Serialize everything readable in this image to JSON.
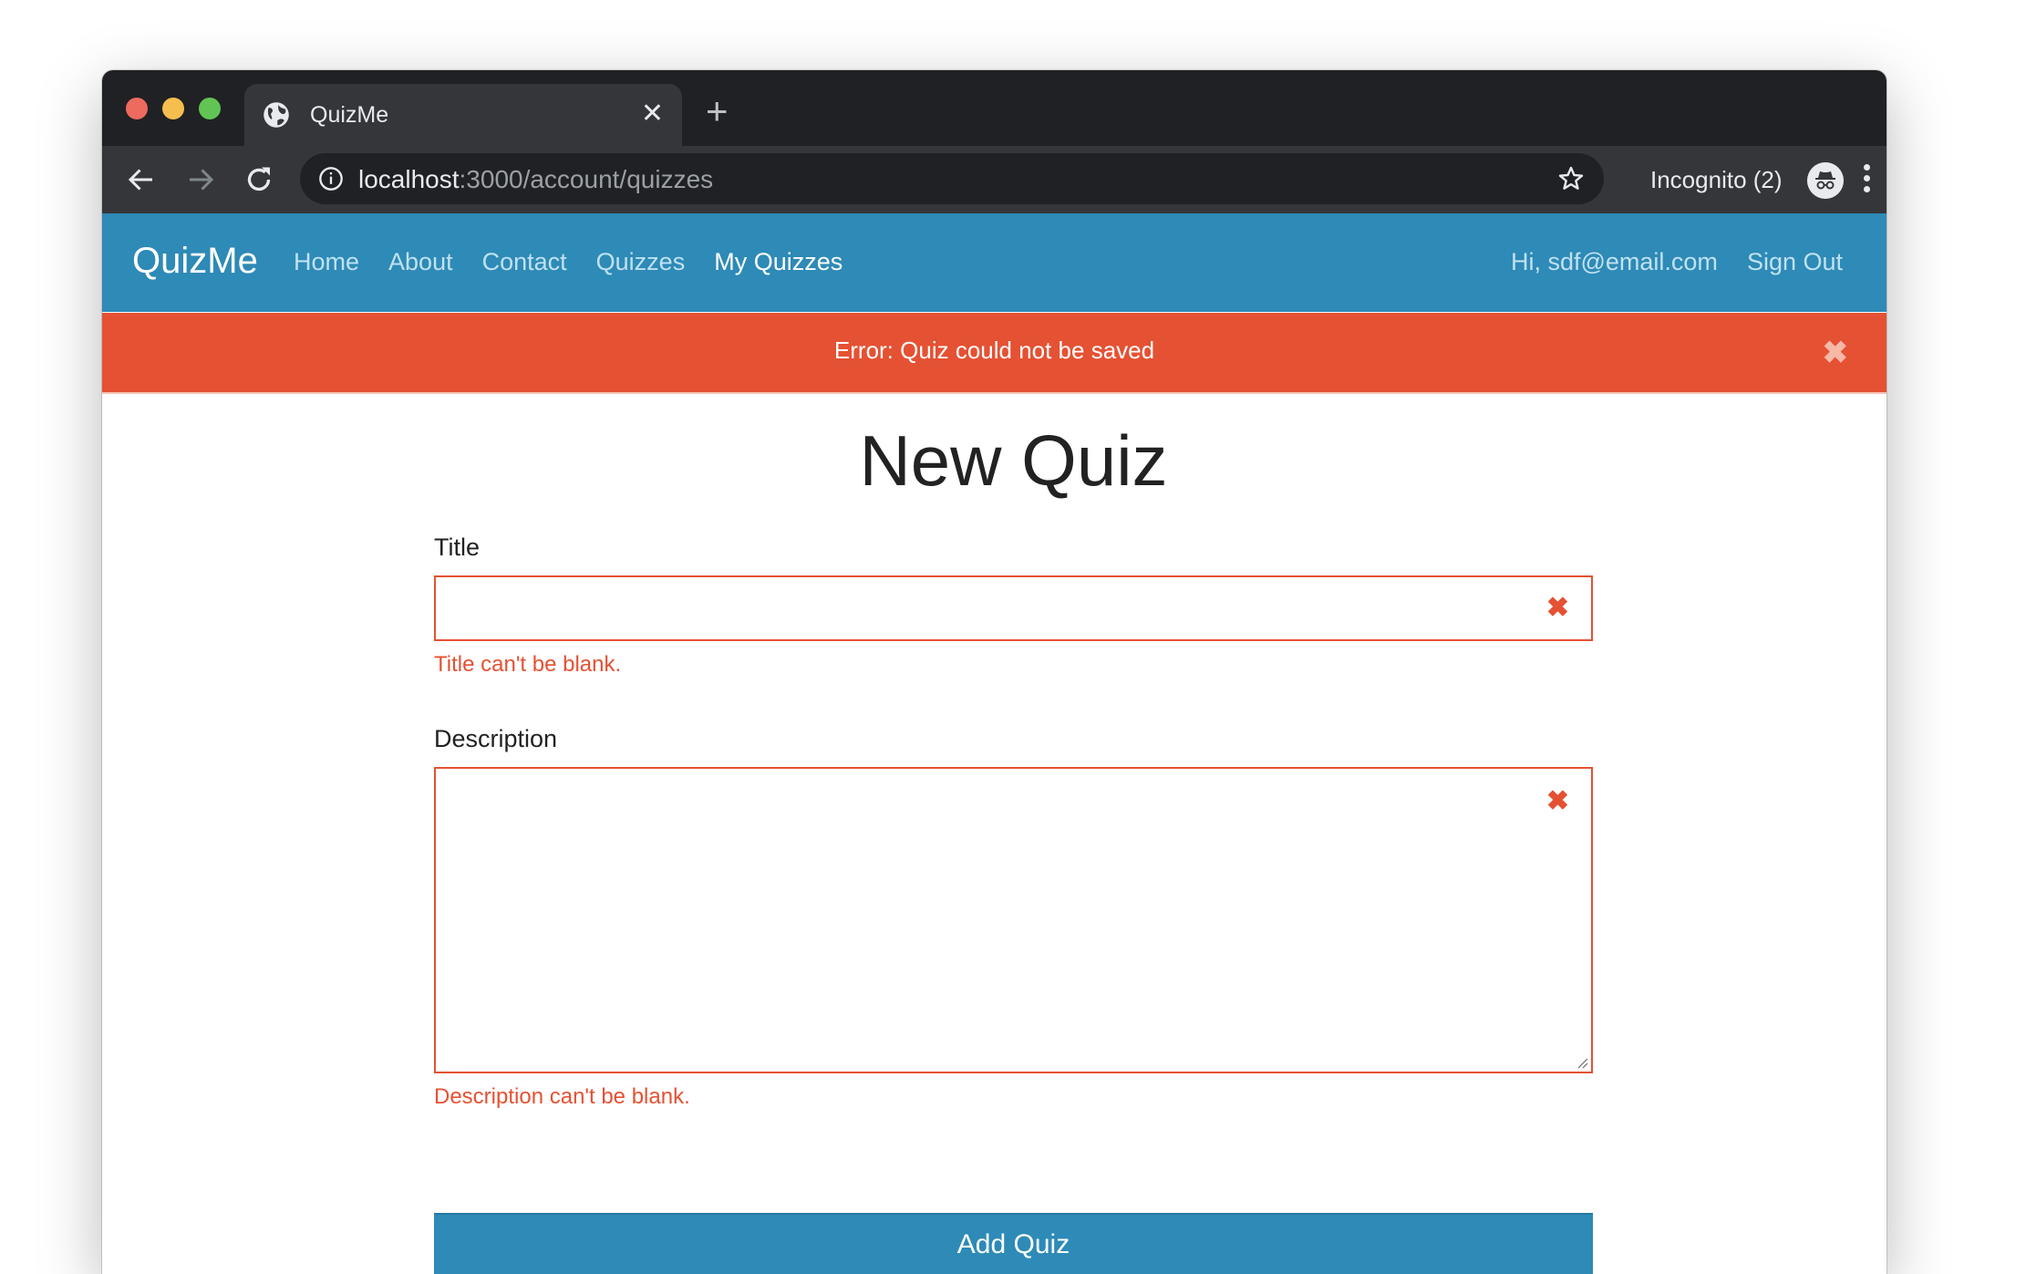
{
  "browser": {
    "tab_title": "QuizMe",
    "new_tab_label": "+",
    "tab_close": "✕",
    "url_host": "localhost",
    "url_rest": ":3000/account/quizzes",
    "incognito_label": "Incognito (2)",
    "icons": {
      "tab": "globe-icon",
      "back": "arrow-left-icon",
      "forward": "arrow-right-icon",
      "reload": "reload-icon",
      "site_info": "info-icon",
      "bookmark": "star-icon",
      "incognito": "incognito-icon",
      "menu": "kebab-menu-icon"
    }
  },
  "navbar": {
    "brand": "QuizMe",
    "links": [
      {
        "label": "Home",
        "active": false
      },
      {
        "label": "About",
        "active": false
      },
      {
        "label": "Contact",
        "active": false
      },
      {
        "label": "Quizzes",
        "active": false
      },
      {
        "label": "My Quizzes",
        "active": true
      }
    ],
    "greeting": "Hi, sdf@email.com",
    "sign_out": "Sign Out"
  },
  "alert": {
    "message": "Error: Quiz could not be saved",
    "close": "✖"
  },
  "form": {
    "title": "New Quiz",
    "fields": {
      "title": {
        "label": "Title",
        "value": "",
        "error": "Title can't be blank."
      },
      "description": {
        "label": "Description",
        "value": "",
        "error": "Description can't be blank."
      }
    },
    "error_icon": "✖",
    "submit_label": "Add Quiz"
  },
  "colors": {
    "navbar": "#2e8ab6",
    "alert": "#e55133",
    "error": "#e55133",
    "button": "#2e8ab6"
  }
}
